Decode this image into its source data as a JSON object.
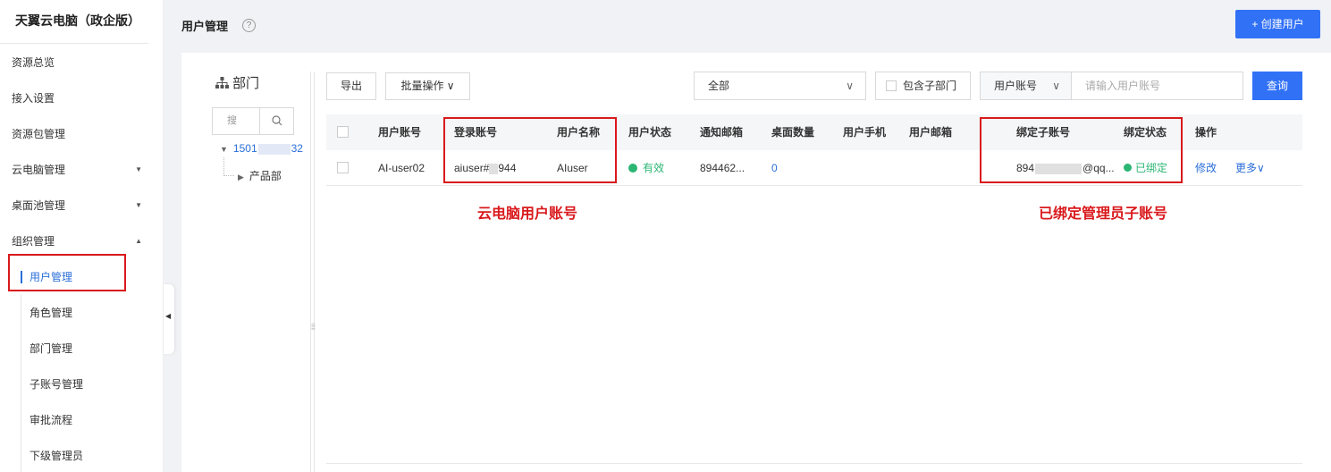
{
  "sidebar": {
    "brand": "天翼云电脑（政企版）",
    "items": [
      {
        "label": "资源总览"
      },
      {
        "label": "接入设置"
      },
      {
        "label": "资源包管理"
      },
      {
        "label": "云电脑管理",
        "arrow": "▼"
      },
      {
        "label": "桌面池管理",
        "arrow": "▼"
      },
      {
        "label": "组织管理",
        "arrow": "▲"
      },
      {
        "label": "用户管理"
      },
      {
        "label": "角色管理"
      },
      {
        "label": "部门管理"
      },
      {
        "label": "子账号管理"
      },
      {
        "label": "审批流程"
      },
      {
        "label": "下级管理员"
      }
    ]
  },
  "header": {
    "title": "用户管理",
    "help": "?",
    "create_button": "+ 创建用户"
  },
  "dept": {
    "title": "部门",
    "search_placeholder": "搜",
    "root_prefix": "1501",
    "root_suffix": "32",
    "child": "产品部"
  },
  "toolbar": {
    "export": "导出",
    "batch": "批量操作 ∨",
    "scope_select": "全部",
    "include_sub": "包含子部门",
    "account_type": "用户账号",
    "search_placeholder": "请输入用户账号",
    "query": "查询"
  },
  "table": {
    "columns": [
      "用户账号",
      "登录账号",
      "用户名称",
      "用户状态",
      "通知邮箱",
      "桌面数量",
      "用户手机",
      "用户邮箱",
      "绑定子账号",
      "绑定状态",
      "操作"
    ],
    "row": {
      "user_account": "AI-user02",
      "login_prefix": "aiuser#",
      "login_suffix": "944",
      "user_name": "AIuser",
      "status": "有效",
      "email": "894462...",
      "desktops": "0",
      "sub_prefix": "894",
      "sub_suffix": "@qq...",
      "bind_status": "已绑定",
      "action_edit": "修改",
      "action_more": "更多∨"
    }
  },
  "annotations": {
    "left": "云电脑用户账号",
    "right": "已绑定管理员子账号"
  },
  "colors": {
    "accent": "#3171f6",
    "status_green": "#2bb673",
    "highlight_red": "#d9191c"
  }
}
